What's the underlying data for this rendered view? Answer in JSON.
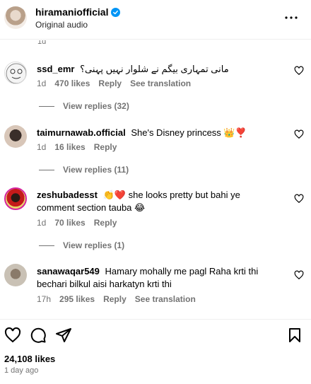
{
  "header": {
    "username": "hiramaniofficial",
    "subtitle": "Original audio"
  },
  "comments_section": {
    "previous_time": "1d",
    "comments": [
      {
        "username": "ssd_emr",
        "text": "مانی تمہاری بیگم نے شلوار نہیں پہنی؟",
        "time": "1d",
        "likes": "470 likes",
        "reply": "Reply",
        "translation": "See translation",
        "view_replies": "View replies (32)"
      },
      {
        "username": "taimurnawab.official",
        "text": "She's Disney princess 👑❣️",
        "time": "1d",
        "likes": "16 likes",
        "reply": "Reply",
        "view_replies": "View replies (11)"
      },
      {
        "username": "zeshubadesst",
        "text": "👏❤️ she looks pretty but bahi ye comment section tauba 😂",
        "time": "1d",
        "likes": "70 likes",
        "reply": "Reply",
        "view_replies": "View replies (1)"
      },
      {
        "username": "sanawaqar549",
        "text": "Hamary mohally me pagl Raha krti thi bechari bilkul aisi harkatyn krti thi",
        "time": "17h",
        "likes": "295 likes",
        "reply": "Reply",
        "translation": "See translation"
      }
    ]
  },
  "footer": {
    "likes": "24,108 likes",
    "time_ago": "1 day ago"
  },
  "colors": {
    "verified": "#0095f6",
    "muted": "#737373"
  }
}
